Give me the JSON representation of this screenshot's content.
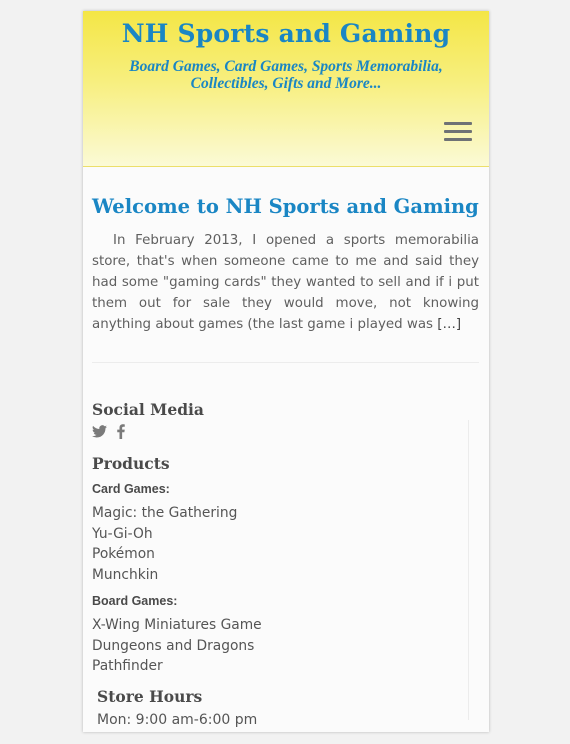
{
  "header": {
    "title": "NH Sports and Gaming",
    "tagline": "Board Games, Card Games, Sports Memorabilia, Collectibles, Gifts and More..."
  },
  "menu": {
    "icon": "hamburger-menu-icon"
  },
  "post": {
    "title": "Welcome to NH Sports and Gaming",
    "excerpt": "In February 2013, I opened a sports memorabilia store, that's when someone came to me and said they had some \"gaming cards\" they wanted to sell and if i put them out for sale they would move, not knowing anything about games (the last game i played was ",
    "more_link": "[…]"
  },
  "sidebar": {
    "social": {
      "title": "Social Media",
      "icons": [
        "twitter-icon",
        "facebook-icon"
      ]
    },
    "products": {
      "title": "Products",
      "card_games": {
        "heading": "Card Games:",
        "items": [
          "Magic: the Gathering",
          "Yu-Gi-Oh",
          "Pokémon",
          "Munchkin"
        ]
      },
      "board_games": {
        "heading": "Board Games:",
        "items": [
          "X-Wing Miniatures Game",
          "Dungeons and Dragons",
          "Pathfinder"
        ]
      }
    },
    "hours": {
      "title": "Store Hours",
      "lines": [
        "Mon: 9:00 am-6:00 pm"
      ]
    }
  },
  "colors": {
    "title_blue": "#1a86c4",
    "header_yellow": "#f4e646",
    "icon_gray": "#7a7a7a"
  }
}
